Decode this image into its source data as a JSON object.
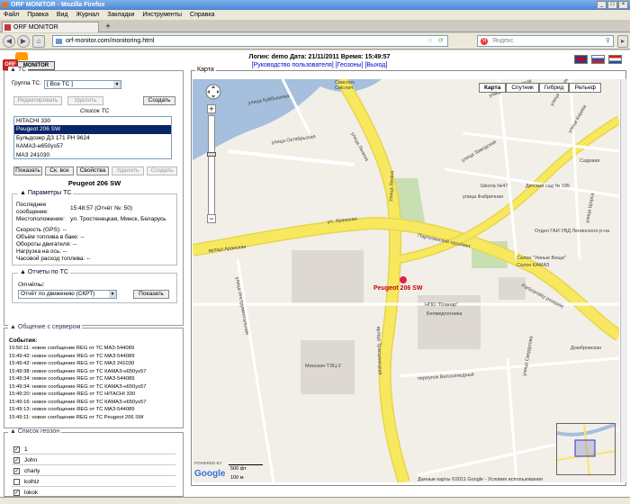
{
  "browser": {
    "window_title": "ORF MONITOR - Mozilla Firefox",
    "menu": [
      "Файл",
      "Правка",
      "Вид",
      "Журнал",
      "Закладки",
      "Инструменты",
      "Справка"
    ],
    "tab_title": "ORF MONITOR",
    "tab_new": "+",
    "url": "orf-monitor.com/monitoring.html",
    "search_placeholder": "Яндекс",
    "search_logo": "Я"
  },
  "logo": {
    "mark": "ORF",
    "text": "MONITOR"
  },
  "header": {
    "info": "Логин: demo  Дата: 21/11/2011  Время: 15:49:57",
    "links": "[Руководство пользователя] [Геозоны] [Выход]"
  },
  "tc_panel": {
    "legend": "ТС",
    "group_label": "Группа ТС:",
    "group_value": "[ Все ТС ]",
    "btn_edit": "Редактировать",
    "btn_delete": "Удалить",
    "btn_create": "Создать",
    "list_title": "Список ТС",
    "list": [
      "HITACHI 330",
      "Peugeot 206 SW",
      "Бульдозер ДЗ 171 РН 9624",
      "КАМАЗ-н650уs57",
      "МАЗ 241030"
    ],
    "btn_show": "Показать",
    "btn_hide_all": "Ск. все",
    "btn_props": "Свойства",
    "btn_delete2": "Удалить",
    "btn_create2": "Создать",
    "selected_name": "Peugeot 206 SW",
    "params_legend": "Параметры ТС",
    "last_msg_label": "Последнее сообщение:",
    "last_msg_value": "15:48:57 (Отчёт №: 50)",
    "location_label": "Местоположение:",
    "location_value": "ул. Тростенецкая, Минск, Беларусь",
    "speed": "Скорость (GPS): --",
    "fuel": "Объём топлива в баке: --",
    "rpm": "Обороты двигателя: --",
    "axle": "Нагрузка на ось: --",
    "consumption": "Часовой расход топлива: --",
    "reports_legend": "Отчеты по ТС",
    "reports_label": "Отчёты:",
    "reports_value": "Отчёт по движению (СКРТ)",
    "btn_report": "Показать"
  },
  "server_panel": {
    "legend": "Общение с сервером",
    "events_title": "События:",
    "events": [
      "15:50:11: новое сообщение REG от ТС МАЗ-544089",
      "15:49:42: новое сообщение REG от ТС МАЗ-544089",
      "15:49:42: новое сообщение REG от ТС МАЗ 241030",
      "15:49:38: новое сообщение REG от ТС КАМАЗ-н650уs57",
      "15:49:34: новое сообщение REG от ТС МАЗ-544089",
      "15:49:34: новое сообщение REG от ТС КАМАЗ-н650уs57",
      "15:49:20: новое сообщение REG от ТС HITACHI 330",
      "15:49:16: новое сообщение REG от ТС КАМАЗ-н650уs57",
      "15:49:13: новое сообщение REG от ТС МАЗ-544089",
      "15:49:11: новое сообщение REG от ТС Peugeot 206 SW"
    ]
  },
  "geozones": {
    "legend": "Список геозон",
    "items": [
      {
        "name": "1",
        "checked": true
      },
      {
        "name": "John",
        "checked": true
      },
      {
        "name": "charly",
        "checked": true
      },
      {
        "name": "kolhiz",
        "checked": false
      },
      {
        "name": "lokok",
        "checked": true
      }
    ]
  },
  "map": {
    "legend": "Карта",
    "types": [
      "Карта",
      "Спутник",
      "Гибрид",
      "Рельеф"
    ],
    "active_type": "Карта",
    "marker_label": "Peugeot 206 SW",
    "copyright": "Данные карты ©2011 Google - Условия использования",
    "scale_ft": "500 фт",
    "scale_m": "100 м",
    "google": "Google",
    "powered": "POWERED BY",
    "labels": {
      "svisloch": "Свислоч",
      "svislach": "Свіслач",
      "kuybysheva": "улица Куйбышева",
      "oktyabrskaya": "улица Октябрьская",
      "lenina": "улица Ленина",
      "ulica_lenina": "Улица Леніна",
      "aranskaya": "ул. Аранская",
      "arnaskaya2": "вуліца Аранская",
      "partizansky": "Партизанский проспект",
      "partizansky2": "Partizanskiy prospekt",
      "trostenetskaya": "вуліца Трасцянецкая",
      "ispolnitelnaya": "улица Инструментальная",
      "velosipedny": "переулок Велосипедный",
      "belmedtehnika": "Белмедтехника",
      "npo": "НПО \"Планар\"",
      "minsk_tec": "Минская ТЭЦ-2",
      "zavodskaya": "улица Заводская",
      "fabrichnaya": "улица Фабричная",
      "salon": "Салон \"Умные Вещи\"",
      "salon2": "Салон КАМАЗ",
      "gaiu": "Отдел ГАИ УВД Ленинского р-на",
      "sadovaya": "Садовая",
      "n47": "Школа №47",
      "n195": "Детский сад № 195",
      "kosmonavtov": "улица Космонавтов",
      "cherv": "улица Червякова",
      "vakhtina": "улица Кирова",
      "shorsa": "улица Щорса",
      "sverdlova": "улица Свердлова",
      "domb": "Домбровская"
    }
  },
  "colors": {
    "road_yellow": "#f7e85f",
    "road_white": "#ffffff",
    "water": "#a5bfdd",
    "park": "#c8dfb2",
    "marker": "#e0204a",
    "title_blue": "#4a86d4"
  }
}
